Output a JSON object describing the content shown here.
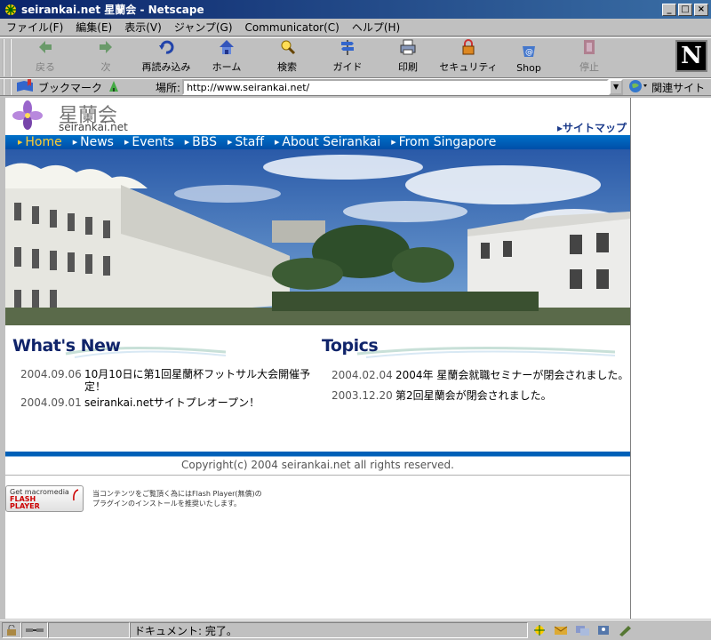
{
  "window": {
    "title": "seirankai.net  星蘭会 - Netscape",
    "controls": [
      "minimize",
      "maximize",
      "close"
    ]
  },
  "menubar": {
    "items": [
      "ファイル(F)",
      "編集(E)",
      "表示(V)",
      "ジャンプ(G)",
      "Communicator(C)",
      "ヘルプ(H)"
    ]
  },
  "toolbar": {
    "buttons": [
      {
        "label": "戻る",
        "icon": "back-arrow-icon",
        "enabled": false
      },
      {
        "label": "次",
        "icon": "forward-arrow-icon",
        "enabled": false
      },
      {
        "label": "再読み込み",
        "icon": "reload-icon",
        "enabled": true
      },
      {
        "label": "ホーム",
        "icon": "home-icon",
        "enabled": true
      },
      {
        "label": "検索",
        "icon": "search-icon",
        "enabled": true
      },
      {
        "label": "ガイド",
        "icon": "guide-icon",
        "enabled": true
      },
      {
        "label": "印刷",
        "icon": "print-icon",
        "enabled": true
      },
      {
        "label": "セキュリティ",
        "icon": "security-lock-icon",
        "enabled": true
      },
      {
        "label": "Shop",
        "icon": "shop-icon",
        "enabled": true
      },
      {
        "label": "停止",
        "icon": "stop-icon",
        "enabled": false
      }
    ],
    "brand": "N"
  },
  "locationbar": {
    "bookmarks_label": "ブックマーク",
    "location_label": "場所:",
    "url": "http://www.seirankai.net/",
    "related_label": "関連サイト"
  },
  "page": {
    "site_name": "星蘭会",
    "site_domain": "seirankai.net",
    "sitemap_label": "サイトマップ",
    "nav": [
      {
        "label": "Home",
        "active": true
      },
      {
        "label": "News",
        "active": false
      },
      {
        "label": "Events",
        "active": false
      },
      {
        "label": "BBS",
        "active": false
      },
      {
        "label": "Staff",
        "active": false
      },
      {
        "label": "About Seirankai",
        "active": false
      },
      {
        "label": "From Singapore",
        "active": false
      }
    ],
    "whats_new": {
      "title": "What's New",
      "items": [
        {
          "date": "2004.09.06",
          "text": "10月10日に第1回星蘭杯フットサル大会開催予定！"
        },
        {
          "date": "2004.09.01",
          "text": "seirankai.netサイトプレオープン！"
        }
      ]
    },
    "topics": {
      "title": "Topics",
      "items": [
        {
          "date": "2004.02.04",
          "text": "2004年 星蘭会就職セミナーが閉会されました。"
        },
        {
          "date": "2003.12.20",
          "text": "第2回星蘭会が閉会されました。"
        }
      ]
    },
    "copyright": "Copyright(c) 2004 seirankai.net all rights reserved.",
    "flash": {
      "badge_top": "Get macromedia",
      "badge_main_1": "FLASH",
      "badge_main_2": "PLAYER",
      "note_line1": "当コンテンツをご覧頂く為にはFlash Player(無償)の",
      "note_line2": "プラグインのインストールを推奨いたします。"
    }
  },
  "statusbar": {
    "text": "ドキュメント: 完了。"
  },
  "colors": {
    "nav_bar": "#0060b8",
    "nav_active": "#ffcc33",
    "section_title": "#10246a",
    "title_bar": "#0a246a"
  }
}
